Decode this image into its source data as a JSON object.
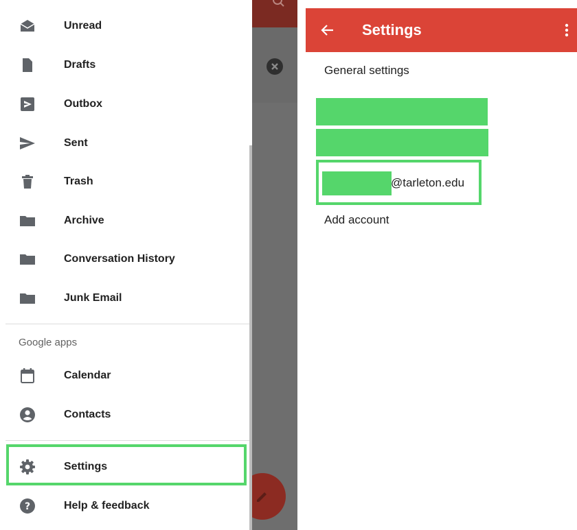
{
  "drawer": {
    "items": [
      {
        "label": "Unread",
        "icon": "envelope-open-icon"
      },
      {
        "label": "Drafts",
        "icon": "file-icon"
      },
      {
        "label": "Outbox",
        "icon": "outbox-icon"
      },
      {
        "label": "Sent",
        "icon": "send-icon"
      },
      {
        "label": "Trash",
        "icon": "trash-icon"
      },
      {
        "label": "Archive",
        "icon": "folder-icon"
      },
      {
        "label": "Conversation History",
        "icon": "folder-icon"
      },
      {
        "label": "Junk Email",
        "icon": "folder-icon"
      }
    ],
    "google_apps": {
      "heading": "Google apps",
      "items": [
        {
          "label": "Calendar",
          "icon": "calendar-icon"
        },
        {
          "label": "Contacts",
          "icon": "account-circle-icon"
        }
      ]
    },
    "footer_items": [
      {
        "label": "Settings",
        "icon": "gear-icon"
      },
      {
        "label": "Help & feedback",
        "icon": "help-icon"
      }
    ]
  },
  "settings_screen": {
    "title": "Settings",
    "general_settings": "General settings",
    "account_email_suffix": "@tarleton.edu",
    "add_account": "Add account"
  },
  "colors": {
    "appbar_red": "#db4437",
    "highlight_green": "#55d66b",
    "icon_gray": "#5f6368"
  }
}
